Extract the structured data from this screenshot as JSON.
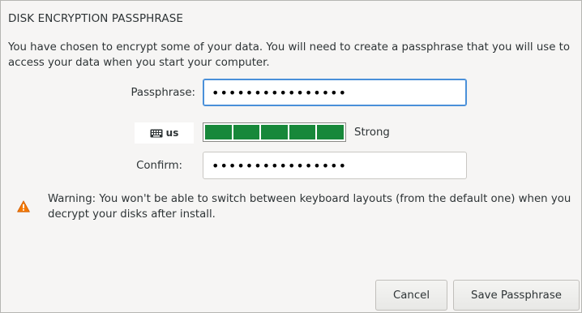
{
  "dialog": {
    "title": "DISK ENCRYPTION PASSPHRASE",
    "description": "You have chosen to encrypt some of your data. You will need to create a passphrase that you will use to access your data when you start your computer."
  },
  "form": {
    "passphrase_label": "Passphrase:",
    "passphrase_value": "••••••••••••••••",
    "confirm_label": "Confirm:",
    "confirm_value": "••••••••••••••••"
  },
  "keyboard": {
    "icon": "keyboard-icon",
    "layout": "us"
  },
  "strength": {
    "segments_filled": 5,
    "segments_total": 5,
    "label": "Strong",
    "color": "#17883a"
  },
  "warning": {
    "icon": "warning-icon",
    "text": "Warning: You won't be able to switch between keyboard layouts (from the default one) when you decrypt your disks after install.",
    "color": "#f57900"
  },
  "buttons": {
    "cancel": "Cancel",
    "save": "Save Passphrase"
  }
}
